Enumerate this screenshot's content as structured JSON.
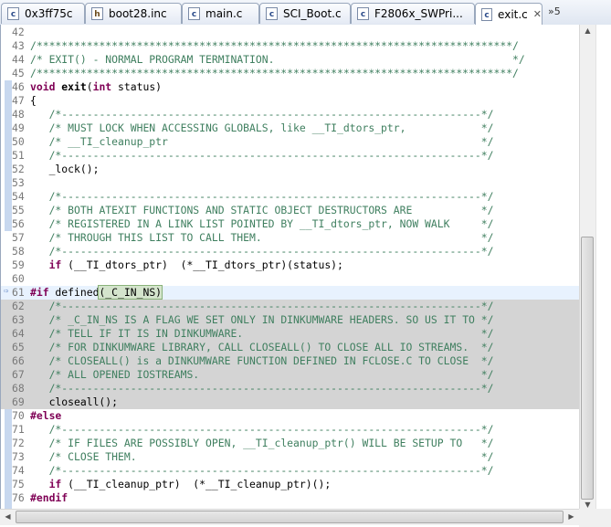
{
  "tabs": [
    {
      "label": "0x3ff75c",
      "icon": "c-source-file-icon",
      "active": false
    },
    {
      "label": "boot28.inc",
      "icon": "header-file-icon",
      "active": false
    },
    {
      "label": "main.c",
      "icon": "c-source-file-icon",
      "active": false
    },
    {
      "label": "SCI_Boot.c",
      "icon": "c-source-file-icon",
      "active": false
    },
    {
      "label": "F2806x_SWPri...",
      "icon": "c-source-file-icon",
      "active": false
    },
    {
      "label": "exit.c",
      "icon": "c-source-file-icon",
      "active": true
    }
  ],
  "overflow_label": "»5",
  "close_glyph": "✕",
  "file_glyph": "c",
  "header_glyph": "h",
  "lines": [
    {
      "n": "42",
      "t": "",
      "k": "plain"
    },
    {
      "n": "43",
      "t": "/****************************************************************************/",
      "k": "comment"
    },
    {
      "n": "44",
      "t": "/* EXIT() - NORMAL PROGRAM TERMINATION.                                      */",
      "k": "comment"
    },
    {
      "n": "45",
      "t": "/****************************************************************************/",
      "k": "comment"
    },
    {
      "n": "46",
      "t": "void exit(int status)",
      "k": "sig"
    },
    {
      "n": "47",
      "t": "{",
      "k": "plain"
    },
    {
      "n": "48",
      "t": "   /*-------------------------------------------------------------------*/",
      "k": "comment"
    },
    {
      "n": "49",
      "t": "   /* MUST LOCK WHEN ACCESSING GLOBALS, like __TI_dtors_ptr,            */",
      "k": "comment"
    },
    {
      "n": "50",
      "t": "   /* __TI_cleanup_ptr                                                  */",
      "k": "comment"
    },
    {
      "n": "51",
      "t": "   /*-------------------------------------------------------------------*/",
      "k": "comment"
    },
    {
      "n": "52",
      "t": "   _lock();",
      "k": "plain"
    },
    {
      "n": "53",
      "t": "",
      "k": "plain"
    },
    {
      "n": "54",
      "t": "   /*-------------------------------------------------------------------*/",
      "k": "comment"
    },
    {
      "n": "55",
      "t": "   /* BOTH ATEXIT FUNCTIONS AND STATIC OBJECT DESTRUCTORS ARE           */",
      "k": "comment"
    },
    {
      "n": "56",
      "t": "   /* REGISTERED IN A LINK LIST POINTED BY __TI_dtors_ptr, NOW WALK     */",
      "k": "comment"
    },
    {
      "n": "57",
      "t": "   /* THROUGH THIS LIST TO CALL THEM.                                   */",
      "k": "comment"
    },
    {
      "n": "58",
      "t": "   /*-------------------------------------------------------------------*/",
      "k": "comment"
    },
    {
      "n": "59",
      "t": "   if (__TI_dtors_ptr)  (*__TI_dtors_ptr)(status);",
      "k": "if"
    },
    {
      "n": "60",
      "t": "",
      "k": "plain"
    },
    {
      "n": "61",
      "t": "#if defined(_C_IN_NS)",
      "k": "ifdef"
    },
    {
      "n": "62",
      "t": "   /*-------------------------------------------------------------------*/",
      "k": "comment"
    },
    {
      "n": "63",
      "t": "   /* _C_IN_NS IS A FLAG WE SET ONLY IN DINKUMWARE HEADERS. SO US IT TO */",
      "k": "comment"
    },
    {
      "n": "64",
      "t": "   /* TELL IF IT IS IN DINKUMWARE.                                      */",
      "k": "comment"
    },
    {
      "n": "65",
      "t": "   /* FOR DINKUMWARE LIBRARY, CALL CLOSEALL() TO CLOSE ALL IO STREAMS.  */",
      "k": "comment"
    },
    {
      "n": "66",
      "t": "   /* CLOSEALL() is a DINKUMWARE FUNCTION DEFINED IN FCLOSE.C TO CLOSE  */",
      "k": "comment"
    },
    {
      "n": "67",
      "t": "   /* ALL OPENED IOSTREAMS.                                             */",
      "k": "comment"
    },
    {
      "n": "68",
      "t": "   /*-------------------------------------------------------------------*/",
      "k": "comment"
    },
    {
      "n": "69",
      "t": "   closeall();",
      "k": "plain"
    },
    {
      "n": "70",
      "t": "#else",
      "k": "pp"
    },
    {
      "n": "71",
      "t": "   /*-------------------------------------------------------------------*/",
      "k": "comment"
    },
    {
      "n": "72",
      "t": "   /* IF FILES ARE POSSIBLY OPEN, __TI_cleanup_ptr() WILL BE SETUP TO   */",
      "k": "comment"
    },
    {
      "n": "73",
      "t": "   /* CLOSE THEM.                                                       */",
      "k": "comment"
    },
    {
      "n": "74",
      "t": "   /*-------------------------------------------------------------------*/",
      "k": "comment"
    },
    {
      "n": "75",
      "t": "   if (__TI_cleanup_ptr)  (*__TI_cleanup_ptr)();",
      "k": "if"
    },
    {
      "n": "76",
      "t": "#endif",
      "k": "pp"
    }
  ],
  "current_line": "61",
  "inactive_lines": [
    "62",
    "63",
    "64",
    "65",
    "66",
    "67",
    "68",
    "69"
  ]
}
